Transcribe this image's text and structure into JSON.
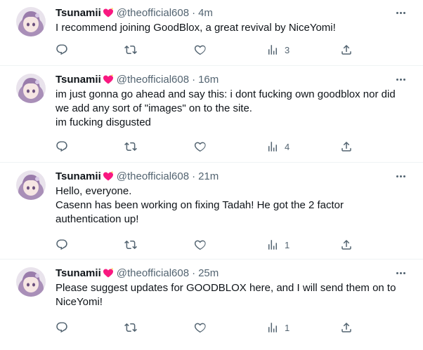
{
  "colors": {
    "text": "#0f1419",
    "secondary": "#536471",
    "divider": "#eff3f4",
    "badge_heart": "#f91880"
  },
  "tweets": [
    {
      "name": "Tsunamii",
      "badge_icon": "sparkling-heart-icon",
      "handle": "@theofficial608",
      "dot": "·",
      "time": "4m",
      "text": "I recommend joining GoodBlox, a great revival by NiceYomi!",
      "views": "3"
    },
    {
      "name": "Tsunamii",
      "badge_icon": "sparkling-heart-icon",
      "handle": "@theofficial608",
      "dot": "·",
      "time": "16m",
      "text": "im just gonna go ahead and say this: i dont fucking own goodblox nor did we add any sort of \"images\" on to the site.\nim fucking disgusted",
      "views": "4"
    },
    {
      "name": "Tsunamii",
      "badge_icon": "sparkling-heart-icon",
      "handle": "@theofficial608",
      "dot": "·",
      "time": "21m",
      "text": "Hello, everyone.\nCasenn has been working on fixing Tadah! He got the 2 factor authentication up!",
      "views": "1"
    },
    {
      "name": "Tsunamii",
      "badge_icon": "sparkling-heart-icon",
      "handle": "@theofficial608",
      "dot": "·",
      "time": "25m",
      "text": "Please suggest updates for GOODBLOX here, and I will send them on to NiceYomi!",
      "views": "1"
    }
  ]
}
